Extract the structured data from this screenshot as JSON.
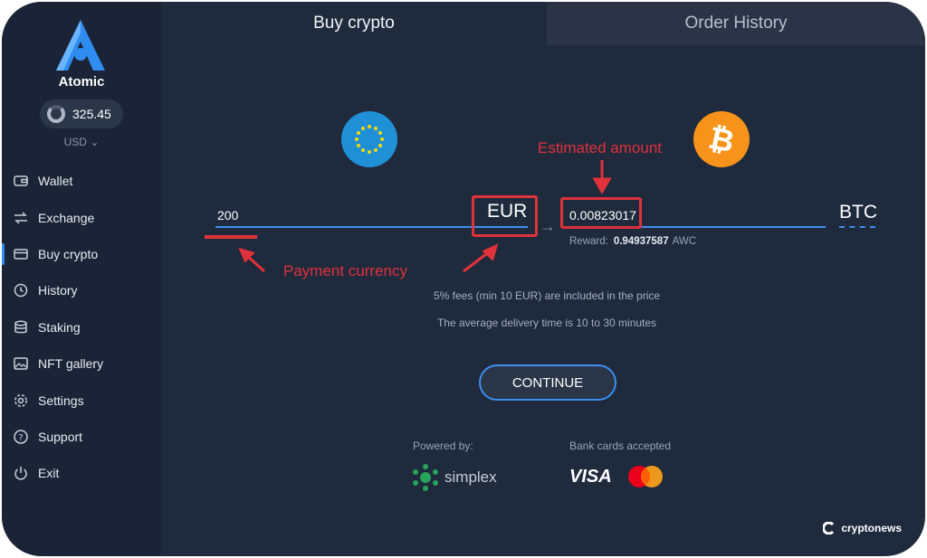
{
  "app": {
    "name": "Atomic",
    "balance": "325.45",
    "currency": "USD"
  },
  "sidebar": {
    "items": [
      {
        "label": "Wallet"
      },
      {
        "label": "Exchange"
      },
      {
        "label": "Buy crypto"
      },
      {
        "label": "History"
      },
      {
        "label": "Staking"
      },
      {
        "label": "NFT gallery"
      },
      {
        "label": "Settings"
      },
      {
        "label": "Support"
      },
      {
        "label": "Exit"
      }
    ]
  },
  "tabs": {
    "buy": "Buy crypto",
    "history": "Order History"
  },
  "form": {
    "amount": "200",
    "pay_currency": "EUR",
    "receive_amount": "0.00823017",
    "receive_currency": "BTC",
    "reward_label": "Reward:",
    "reward_value": "0.94937587",
    "reward_unit": "AWC",
    "fees_note": "5% fees (min 10 EUR) are included in the price",
    "delivery_note": "The average delivery time is 10 to 30 minutes",
    "continue_label": "CONTINUE"
  },
  "annotations": {
    "estimated": "Estimated amount",
    "payment": "Payment currency"
  },
  "footer": {
    "powered_by": "Powered by:",
    "provider": "simplex",
    "bank_cards": "Bank cards accepted",
    "visa": "VISA",
    "watermark": "cryptonews"
  },
  "colors": {
    "accent": "#3d8ef0",
    "annotation": "#e0323a",
    "background": "#1f2a3d"
  }
}
